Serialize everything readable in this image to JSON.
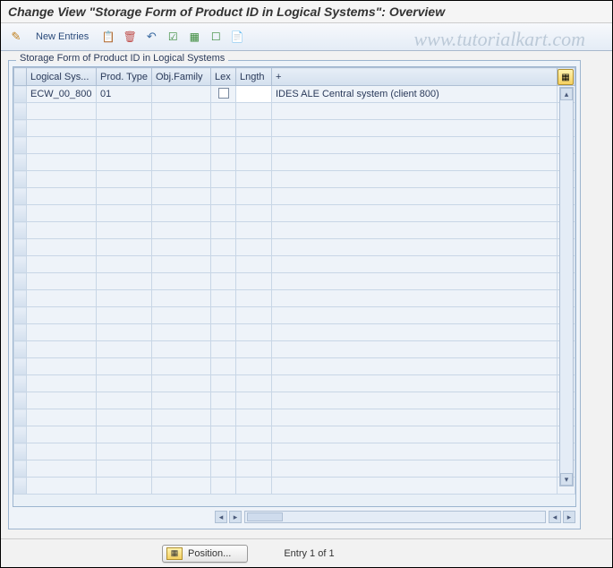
{
  "window_title": "Change View \"Storage Form of Product ID in Logical Systems\": Overview",
  "watermark": "www.tutorialkart.com",
  "toolbar": {
    "new_entries_label": "New Entries"
  },
  "group_title": "Storage Form of Product ID in Logical Systems",
  "table": {
    "columns": [
      "Logical Sys...",
      "Prod. Type",
      "Obj.Family",
      "Lex",
      "Lngth",
      "+"
    ],
    "rows": [
      {
        "logical_system": "ECW_00_800",
        "prod_type": "01",
        "obj_family": "",
        "lex": false,
        "length": "",
        "description": "IDES ALE Central system (client 800)"
      }
    ],
    "empty_rows": 23
  },
  "footer": {
    "position_button": "Position...",
    "entry_status": "Entry 1 of 1"
  }
}
